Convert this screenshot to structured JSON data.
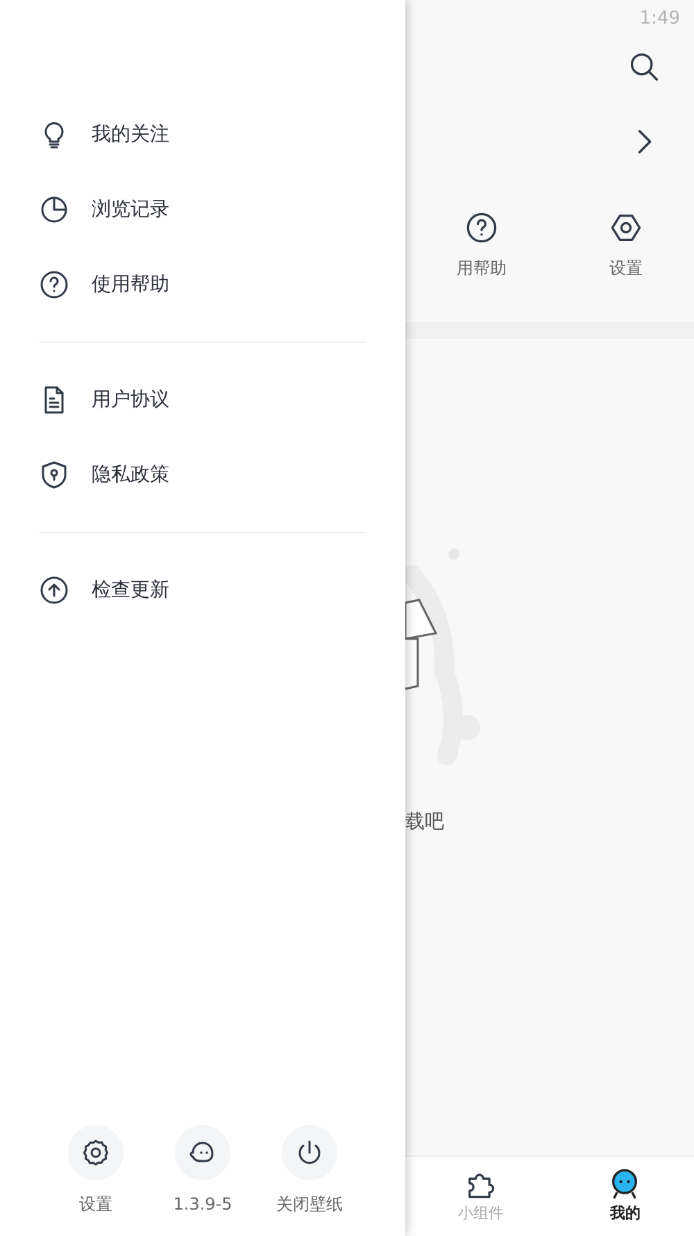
{
  "status_bar": {
    "time": "1:49"
  },
  "drawer": {
    "groups": [
      [
        {
          "kind": "bulb",
          "label": "我的关注"
        },
        {
          "kind": "pie",
          "label": "浏览记录"
        },
        {
          "kind": "help",
          "label": "使用帮助"
        }
      ],
      [
        {
          "kind": "doc",
          "label": "用户协议"
        },
        {
          "kind": "shield",
          "label": "隐私政策"
        }
      ],
      [
        {
          "kind": "up",
          "label": "检查更新"
        }
      ]
    ],
    "bottom_actions": [
      {
        "kind": "gear",
        "label": "设置"
      },
      {
        "kind": "face",
        "label": "1.3.9-5"
      },
      {
        "kind": "power",
        "label": "关闭壁纸"
      }
    ]
  },
  "background": {
    "shortcuts": [
      {
        "kind": "help",
        "label": "用帮助"
      },
      {
        "kind": "hexagon",
        "label": "设置"
      }
    ],
    "empty_message": "载吧",
    "bottom_nav": [
      {
        "kind": "puzzle",
        "label": "小组件",
        "selected": false
      },
      {
        "kind": "robot",
        "label": "我的",
        "selected": true
      }
    ]
  }
}
